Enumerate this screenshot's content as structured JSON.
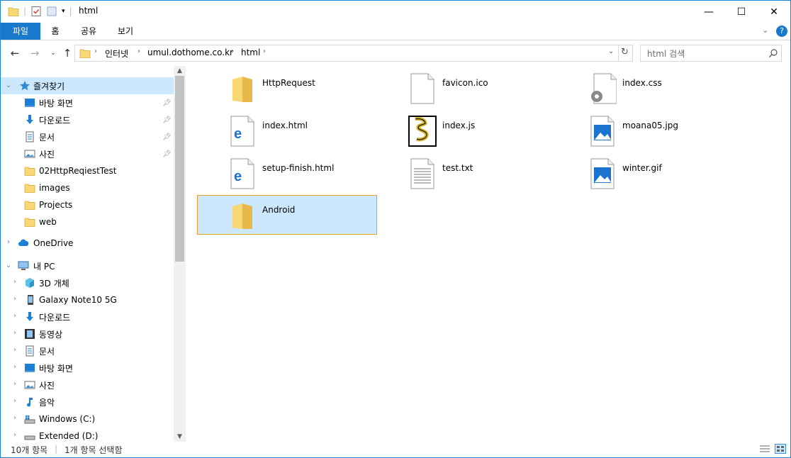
{
  "window": {
    "title": "html",
    "controls": {
      "minimize": "—",
      "maximize": "☐",
      "close": "✕"
    }
  },
  "ribbon": {
    "tabs": [
      {
        "label": "파일"
      },
      {
        "label": "홈"
      },
      {
        "label": "공유"
      },
      {
        "label": "보기"
      }
    ]
  },
  "address": {
    "breadcrumbs": [
      "인터넷",
      "umul.dothome.co.kr",
      "html"
    ]
  },
  "search": {
    "placeholder": "html 검색"
  },
  "sidebar": {
    "quick_access": {
      "label": "즐겨찾기"
    },
    "pinned": [
      {
        "label": "바탕 화면",
        "icon": "desktop-icon"
      },
      {
        "label": "다운로드",
        "icon": "download-icon"
      },
      {
        "label": "문서",
        "icon": "documents-icon"
      },
      {
        "label": "사진",
        "icon": "pictures-icon"
      }
    ],
    "recent": [
      {
        "label": "02HttpReqiestTest"
      },
      {
        "label": "images"
      },
      {
        "label": "Projects"
      },
      {
        "label": "web"
      }
    ],
    "onedrive": {
      "label": "OneDrive"
    },
    "this_pc": {
      "label": "내 PC"
    },
    "pc_items": [
      {
        "label": "3D 개체",
        "icon": "3d-objects-icon"
      },
      {
        "label": "Galaxy Note10 5G",
        "icon": "phone-icon"
      },
      {
        "label": "다운로드",
        "icon": "download-icon"
      },
      {
        "label": "동영상",
        "icon": "videos-icon"
      },
      {
        "label": "문서",
        "icon": "documents-icon"
      },
      {
        "label": "바탕 화면",
        "icon": "desktop-icon"
      },
      {
        "label": "사진",
        "icon": "pictures-icon"
      },
      {
        "label": "음악",
        "icon": "music-icon"
      },
      {
        "label": "Windows (C:)",
        "icon": "drive-c-icon"
      },
      {
        "label": "Extended (D:)",
        "icon": "drive-d-icon"
      }
    ]
  },
  "files": [
    {
      "name": "HttpRequest",
      "type": "folder"
    },
    {
      "name": "favicon.ico",
      "type": "blank"
    },
    {
      "name": "index.css",
      "type": "css"
    },
    {
      "name": "index.html",
      "type": "edge"
    },
    {
      "name": "index.js",
      "type": "script"
    },
    {
      "name": "moana05.jpg",
      "type": "image"
    },
    {
      "name": "setup-finish.html",
      "type": "edge"
    },
    {
      "name": "test.txt",
      "type": "text"
    },
    {
      "name": "winter.gif",
      "type": "image"
    },
    {
      "name": "Android",
      "type": "folder",
      "selected": true
    }
  ],
  "status": {
    "item_count": "10개 항목",
    "selected": "1개 항목 선택함"
  },
  "colors": {
    "accent": "#1979ca",
    "selection": "#cce8ff",
    "folder": "#f8d775"
  }
}
